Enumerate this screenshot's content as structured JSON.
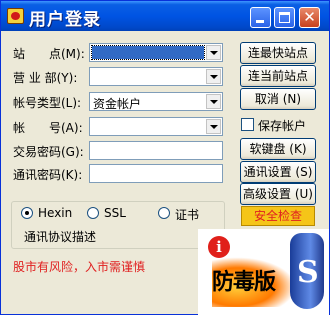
{
  "window": {
    "title": "用户登录"
  },
  "form": {
    "site_label": "站　　点(M):",
    "branch_label": "营 业 部(Y):",
    "account_type_label": "帐号类型(L):",
    "account_type_value": "资金帐户",
    "account_label": "帐　　号(A):",
    "trade_password_label": "交易密码(G):",
    "comm_password_label": "通讯密码(K):"
  },
  "buttons": {
    "fastest_site": "连最快站点",
    "current_site": "连当前站点",
    "cancel": "取消 (N)",
    "soft_keyboard": "软键盘 (K)",
    "comm_settings": "通讯设置 (S)",
    "advanced_settings": "高级设置 (U)",
    "security_check": "安全检查"
  },
  "options": {
    "save_account": "保存帐户"
  },
  "protocol": {
    "hexin": "Hexin",
    "ssl": "SSL",
    "cert": "证书",
    "selected": "Hexin",
    "description": "通讯协议描述"
  },
  "notice": {
    "risk_text": "股市有风险，入市需谨慎"
  },
  "badge": {
    "text": "防毒版",
    "info_glyph": "i"
  },
  "colors": {
    "titlebar": "#0054e3",
    "warn_bg": "#f5c518",
    "risk_text": "#e02020"
  }
}
